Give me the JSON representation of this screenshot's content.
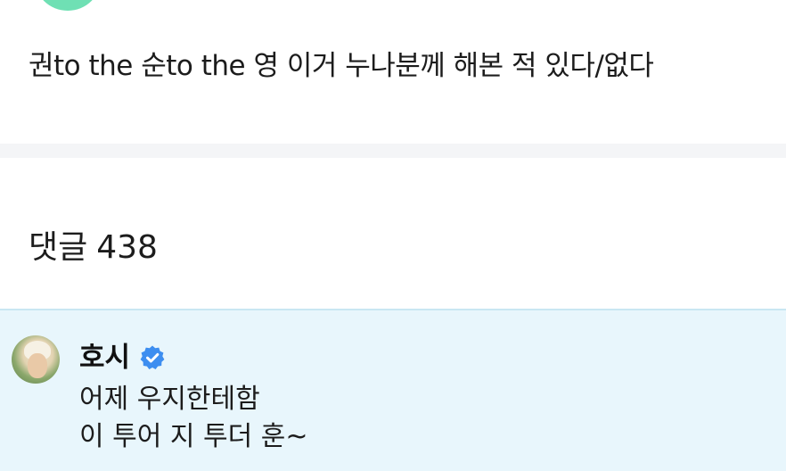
{
  "post": {
    "body": "권to the 순to the 영 이거 누나분께 해본 적 있다/없다"
  },
  "comments": {
    "label": "댓글",
    "count": "438"
  },
  "comment": {
    "author": "호시",
    "lines": [
      "어제 우지한테함",
      "이 투어 지 투더 훈~"
    ]
  },
  "icons": {
    "verified": "verified-badge-icon",
    "avatar": "profile-avatar"
  },
  "colors": {
    "accent_avatar_green": "#6fe0b4",
    "highlight_bg": "#e8f6fc",
    "verified_blue": "#3d8ef0"
  }
}
